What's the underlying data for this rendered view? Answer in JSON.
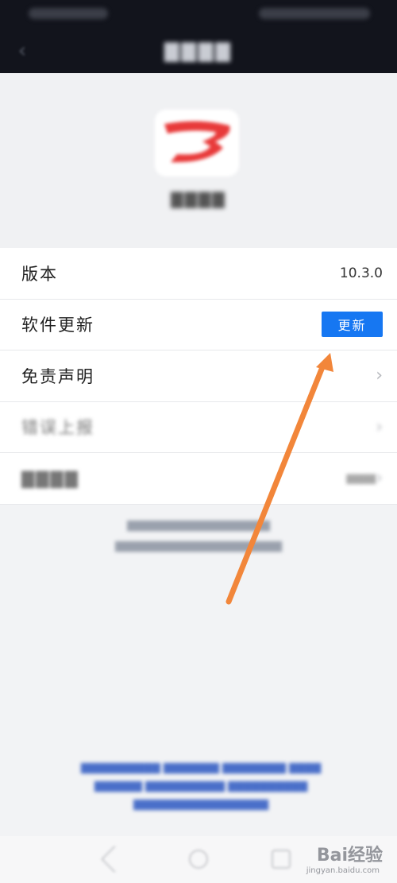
{
  "list": {
    "version": {
      "label": "版本",
      "value": "10.3.0"
    },
    "update": {
      "label": "软件更新",
      "button_label": "更新"
    },
    "disclaimer": {
      "label": "免责声明"
    },
    "error_report": {
      "label": "错误上报"
    },
    "privacy": {
      "label": ""
    }
  },
  "watermark": {
    "brand": "Bai经验",
    "url": "jingyan.baidu.com"
  },
  "colors": {
    "header_bg": "#12141c",
    "accent": "#1677f2",
    "arrow": "#f2863a",
    "logo_red": "#e83a3a"
  },
  "icons": {
    "back": "chevron-left-icon",
    "chevron": "chevron-right-icon"
  }
}
